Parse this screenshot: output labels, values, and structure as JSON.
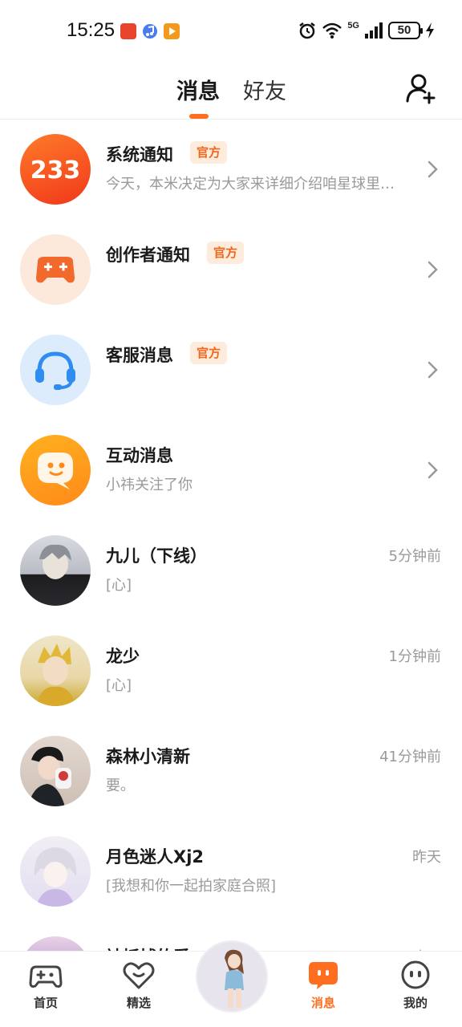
{
  "status_bar": {
    "time": "15:25",
    "battery": "50",
    "network": "5G",
    "icons": [
      "alarm-icon",
      "wifi-icon",
      "signal-icon",
      "charging-icon"
    ]
  },
  "header": {
    "tabs": [
      {
        "label": "消息",
        "active": true
      },
      {
        "label": "好友",
        "active": false
      }
    ],
    "action_icon": "add-friend-icon"
  },
  "messages": [
    {
      "name": "系统通知",
      "badge": "官方",
      "preview": "今天，本米决定为大家来详细介绍咱星球里…",
      "time": "",
      "avatar": "233-logo"
    },
    {
      "name": "创作者通知",
      "badge": "官方",
      "preview": "",
      "time": "",
      "avatar": "gamepad-icon"
    },
    {
      "name": "客服消息",
      "badge": "官方",
      "preview": "",
      "time": "",
      "avatar": "headset-icon"
    },
    {
      "name": "互动消息",
      "badge": "",
      "preview": "小祎关注了你",
      "time": "",
      "avatar": "chat-bubble-icon"
    },
    {
      "name": "九儿（下线）",
      "badge": "",
      "preview": "[心]",
      "time": "5分钟前",
      "avatar": "user-avatar"
    },
    {
      "name": "龙少",
      "badge": "",
      "preview": "[心]",
      "time": "1分钟前",
      "avatar": "user-avatar"
    },
    {
      "name": "森林小清新",
      "badge": "",
      "preview": "要。",
      "time": "41分钟前",
      "avatar": "user-avatar"
    },
    {
      "name": "月色迷人Xj2",
      "badge": "",
      "preview": "[我想和你一起拍家庭合照]",
      "time": "昨天",
      "avatar": "user-avatar"
    },
    {
      "name": "被抓捕的爱",
      "badge": "",
      "preview": "",
      "time": "昨天",
      "avatar": "user-avatar"
    }
  ],
  "bottom_nav": [
    {
      "label": "首页",
      "icon": "gamepad-nav-icon",
      "active": false
    },
    {
      "label": "精选",
      "icon": "heart-nav-icon",
      "active": false
    },
    {
      "label": "消息",
      "icon": "message-nav-icon",
      "active": true
    },
    {
      "label": "我的",
      "icon": "profile-nav-icon",
      "active": false
    }
  ],
  "colors": {
    "accent": "#ff6e1f",
    "badge_bg": "#fdebdc",
    "secondary_text": "#9a9a9a"
  }
}
